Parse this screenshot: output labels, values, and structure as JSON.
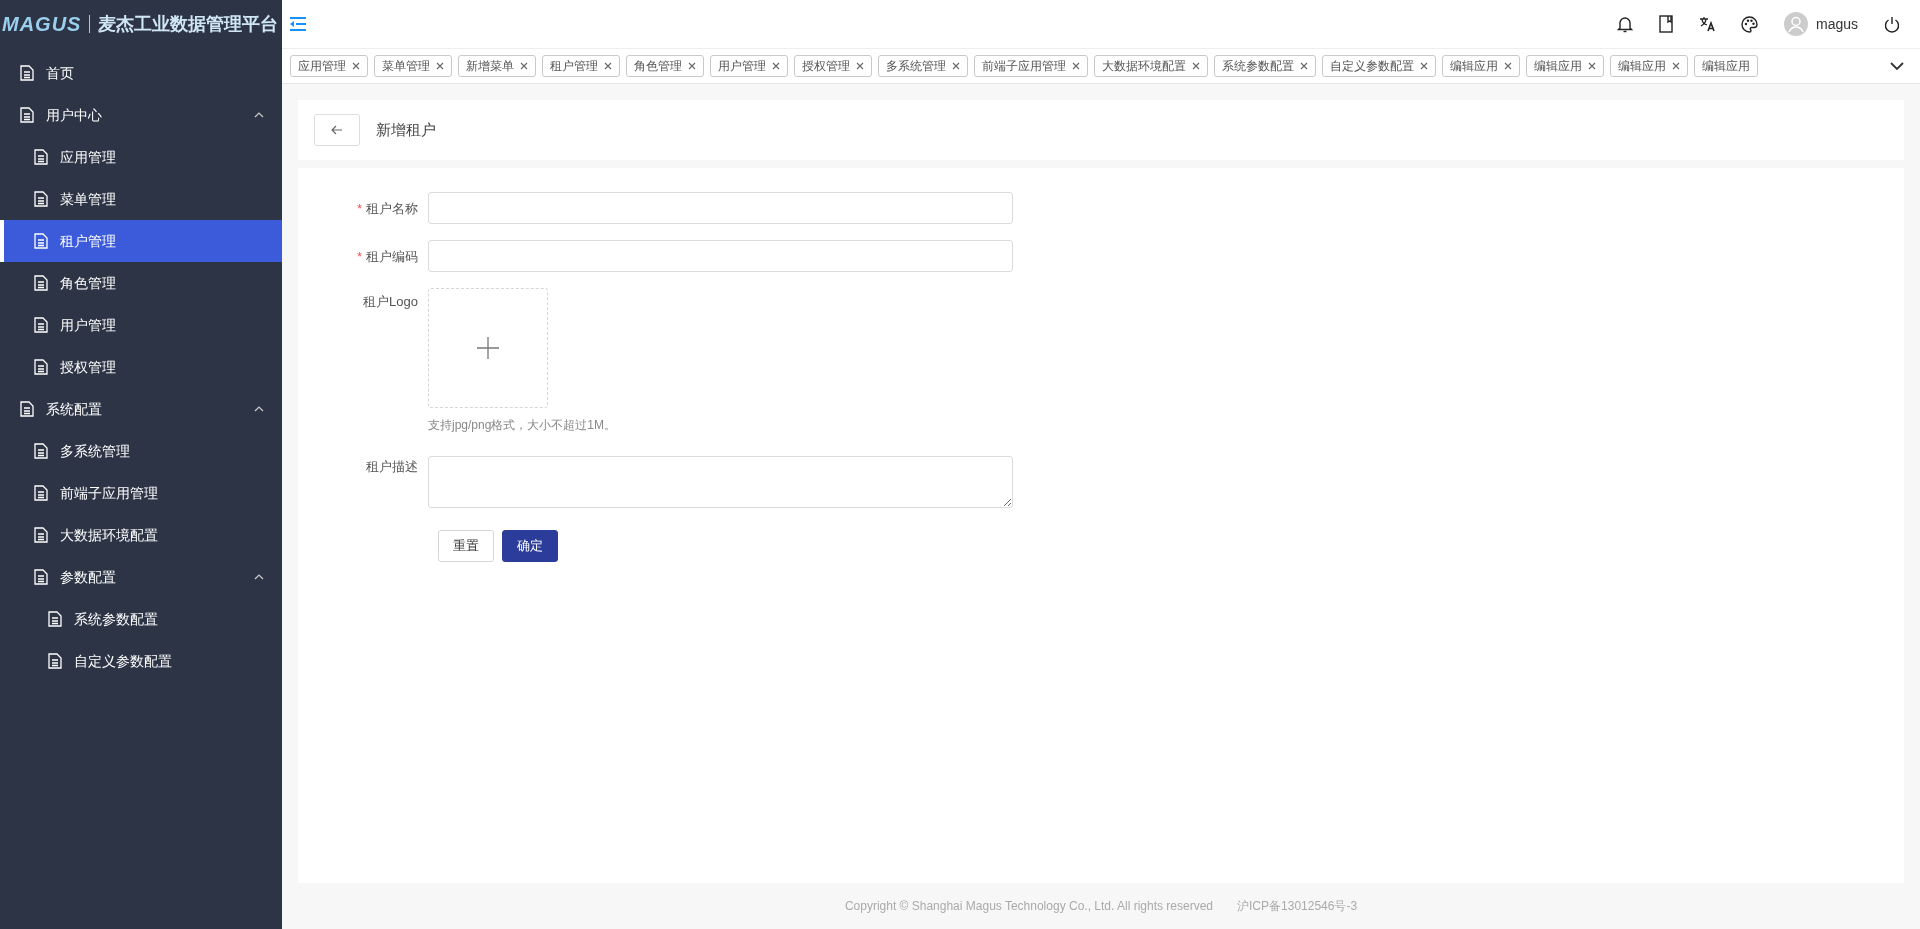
{
  "brand": {
    "logo": "MAGUS",
    "title": "麦杰工业数据管理平台"
  },
  "sidebar": {
    "items": [
      {
        "label": "首页",
        "selected": false
      },
      {
        "label": "用户中心",
        "selected": false,
        "expanded": true,
        "children": [
          {
            "label": "应用管理",
            "selected": false
          },
          {
            "label": "菜单管理",
            "selected": false
          },
          {
            "label": "租户管理",
            "selected": true
          },
          {
            "label": "角色管理",
            "selected": false
          },
          {
            "label": "用户管理",
            "selected": false
          },
          {
            "label": "授权管理",
            "selected": false
          }
        ]
      },
      {
        "label": "系统配置",
        "selected": false,
        "expanded": true,
        "children": [
          {
            "label": "多系统管理",
            "selected": false
          },
          {
            "label": "前端子应用管理",
            "selected": false
          },
          {
            "label": "大数据环境配置",
            "selected": false
          },
          {
            "label": "参数配置",
            "selected": false,
            "expanded": true,
            "children": [
              {
                "label": "系统参数配置",
                "selected": false
              },
              {
                "label": "自定义参数配置",
                "selected": false
              }
            ]
          }
        ]
      }
    ]
  },
  "header": {
    "user": "magus"
  },
  "tabs": [
    {
      "label": "应用管理",
      "closable": true
    },
    {
      "label": "菜单管理",
      "closable": true
    },
    {
      "label": "新增菜单",
      "closable": true
    },
    {
      "label": "租户管理",
      "closable": true
    },
    {
      "label": "角色管理",
      "closable": true
    },
    {
      "label": "用户管理",
      "closable": true
    },
    {
      "label": "授权管理",
      "closable": true
    },
    {
      "label": "多系统管理",
      "closable": true
    },
    {
      "label": "前端子应用管理",
      "closable": true
    },
    {
      "label": "大数据环境配置",
      "closable": true
    },
    {
      "label": "系统参数配置",
      "closable": true
    },
    {
      "label": "自定义参数配置",
      "closable": true
    },
    {
      "label": "编辑应用",
      "closable": true
    },
    {
      "label": "编辑应用",
      "closable": true
    },
    {
      "label": "编辑应用",
      "closable": true
    },
    {
      "label": "编辑应用",
      "closable": false
    }
  ],
  "page": {
    "title": "新增租户"
  },
  "form": {
    "fields": [
      {
        "kind": "input",
        "label": "租户名称",
        "required_marker": "*"
      },
      {
        "kind": "input",
        "label": "租户编码",
        "required_marker": "*"
      },
      {
        "kind": "upload",
        "label": "租户Logo",
        "hint": "支持jpg/png格式，大小不超过1M。"
      },
      {
        "kind": "textarea",
        "label": "租户描述"
      }
    ],
    "buttons": [
      {
        "label": "重置",
        "primary": false
      },
      {
        "label": "确定",
        "primary": true
      }
    ]
  },
  "footer": {
    "copyright": "Copyright © Shanghai Magus Technology Co., Ltd. All rights reserved",
    "icp": "沪ICP备13012546号-3"
  }
}
